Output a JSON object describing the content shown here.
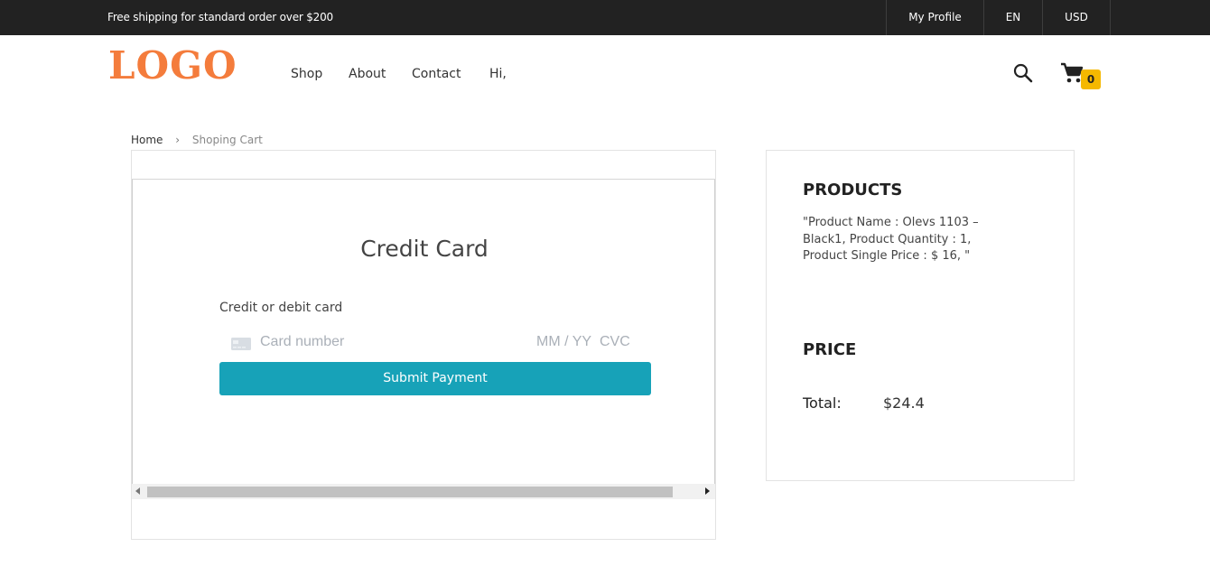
{
  "topbar": {
    "promo": "Free shipping for standard order over $200",
    "my_profile": "My Profile",
    "language": "EN",
    "currency": "USD"
  },
  "header": {
    "logo": "LOGO",
    "nav": [
      "Shop",
      "About",
      "Contact",
      "Hi,"
    ],
    "search_icon": "search-icon",
    "cart_icon": "cart-icon",
    "cart_count": "0"
  },
  "breadcrumb": {
    "home": "Home",
    "separator": "›",
    "current": "Shoping Cart"
  },
  "payment": {
    "title": "Credit Card",
    "card_label": "Credit or debit card",
    "card_number_placeholder": "Card number",
    "expiry_placeholder": "MM / YY",
    "cvc_placeholder": "CVC",
    "submit_label": "Submit Payment"
  },
  "summary": {
    "products_heading": "PRODUCTS",
    "products_text": "\"Product Name : Olevs 1103 – Black1, Product Quantity : 1, Product Single Price : $ 16, \"",
    "price_heading": "PRICE",
    "total_label": "Total:",
    "total_value": "$24.4"
  },
  "colors": {
    "topbar_bg": "#222222",
    "logo": "#f47c3c",
    "badge": "#f5b800",
    "submit_button": "#17a2b8"
  }
}
